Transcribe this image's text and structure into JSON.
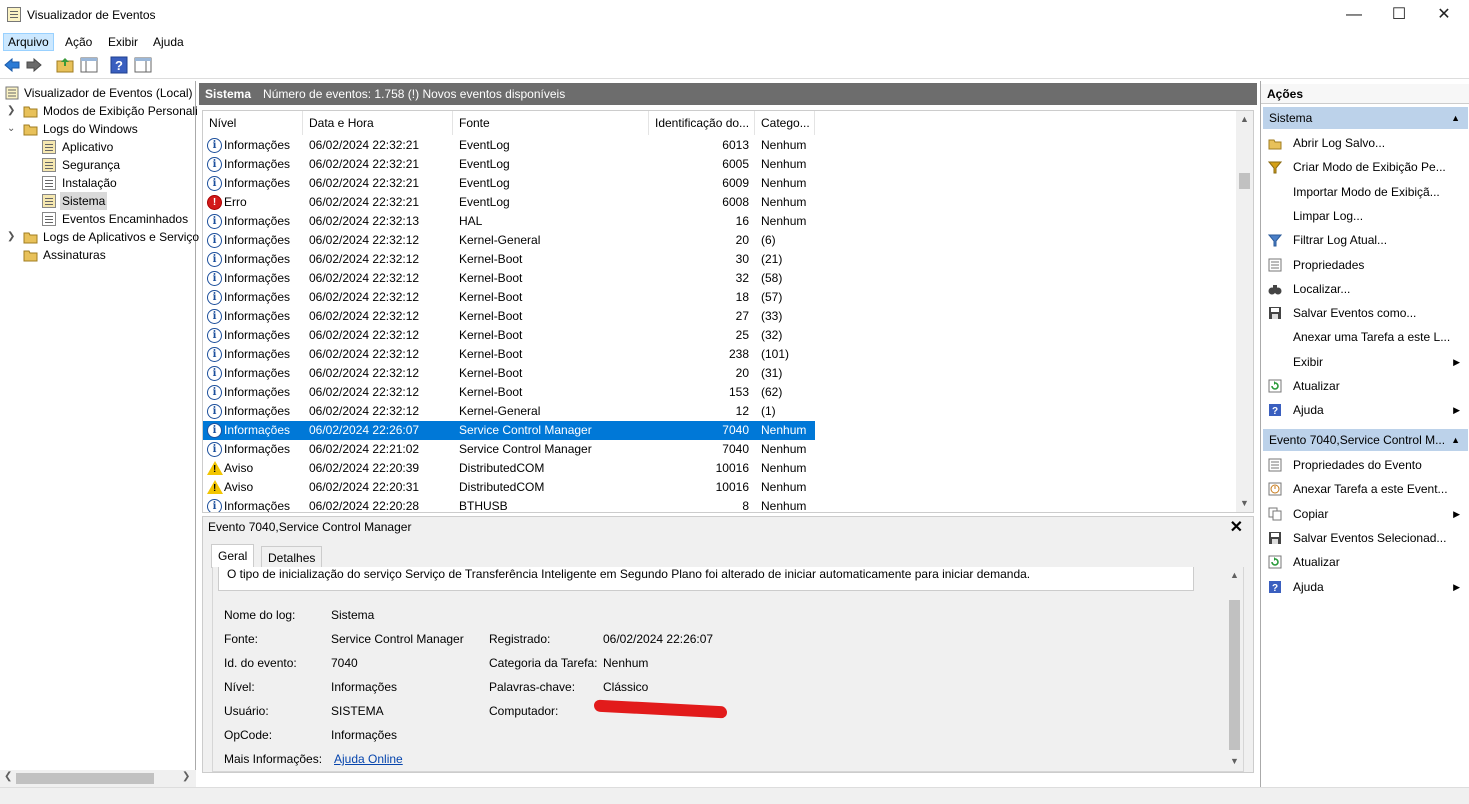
{
  "window": {
    "title": "Visualizador de Eventos"
  },
  "menu": [
    "Arquivo",
    "Ação",
    "Exibir",
    "Ajuda"
  ],
  "tree": {
    "root": "Visualizador de Eventos (Local)",
    "custom_views": "Modos de Exibição Personali",
    "windows_logs": "Logs do Windows",
    "app": "Aplicativo",
    "security": "Segurança",
    "setup": "Instalação",
    "system": "Sistema",
    "forwarded": "Eventos Encaminhados",
    "apps_services": "Logs de Aplicativos e Serviço",
    "subscriptions": "Assinaturas"
  },
  "header": {
    "log": "Sistema",
    "info": "Número de eventos: 1.758 (!) Novos eventos disponíveis"
  },
  "columns": [
    "Nível",
    "Data e Hora",
    "Fonte",
    "Identificação do...",
    "Catego..."
  ],
  "events": [
    {
      "level": "Informações",
      "type": "info",
      "date": "06/02/2024 22:32:21",
      "source": "EventLog",
      "id": "6013",
      "cat": "Nenhum"
    },
    {
      "level": "Informações",
      "type": "info",
      "date": "06/02/2024 22:32:21",
      "source": "EventLog",
      "id": "6005",
      "cat": "Nenhum"
    },
    {
      "level": "Informações",
      "type": "info",
      "date": "06/02/2024 22:32:21",
      "source": "EventLog",
      "id": "6009",
      "cat": "Nenhum"
    },
    {
      "level": "Erro",
      "type": "error",
      "date": "06/02/2024 22:32:21",
      "source": "EventLog",
      "id": "6008",
      "cat": "Nenhum"
    },
    {
      "level": "Informações",
      "type": "info",
      "date": "06/02/2024 22:32:13",
      "source": "HAL",
      "id": "16",
      "cat": "Nenhum"
    },
    {
      "level": "Informações",
      "type": "info",
      "date": "06/02/2024 22:32:12",
      "source": "Kernel-General",
      "id": "20",
      "cat": "(6)"
    },
    {
      "level": "Informações",
      "type": "info",
      "date": "06/02/2024 22:32:12",
      "source": "Kernel-Boot",
      "id": "30",
      "cat": "(21)"
    },
    {
      "level": "Informações",
      "type": "info",
      "date": "06/02/2024 22:32:12",
      "source": "Kernel-Boot",
      "id": "32",
      "cat": "(58)"
    },
    {
      "level": "Informações",
      "type": "info",
      "date": "06/02/2024 22:32:12",
      "source": "Kernel-Boot",
      "id": "18",
      "cat": "(57)"
    },
    {
      "level": "Informações",
      "type": "info",
      "date": "06/02/2024 22:32:12",
      "source": "Kernel-Boot",
      "id": "27",
      "cat": "(33)"
    },
    {
      "level": "Informações",
      "type": "info",
      "date": "06/02/2024 22:32:12",
      "source": "Kernel-Boot",
      "id": "25",
      "cat": "(32)"
    },
    {
      "level": "Informações",
      "type": "info",
      "date": "06/02/2024 22:32:12",
      "source": "Kernel-Boot",
      "id": "238",
      "cat": "(101)"
    },
    {
      "level": "Informações",
      "type": "info",
      "date": "06/02/2024 22:32:12",
      "source": "Kernel-Boot",
      "id": "20",
      "cat": "(31)"
    },
    {
      "level": "Informações",
      "type": "info",
      "date": "06/02/2024 22:32:12",
      "source": "Kernel-Boot",
      "id": "153",
      "cat": "(62)"
    },
    {
      "level": "Informações",
      "type": "info",
      "date": "06/02/2024 22:32:12",
      "source": "Kernel-General",
      "id": "12",
      "cat": "(1)"
    },
    {
      "level": "Informações",
      "type": "info",
      "date": "06/02/2024 22:26:07",
      "source": "Service Control Manager",
      "id": "7040",
      "cat": "Nenhum",
      "selected": true
    },
    {
      "level": "Informações",
      "type": "info",
      "date": "06/02/2024 22:21:02",
      "source": "Service Control Manager",
      "id": "7040",
      "cat": "Nenhum"
    },
    {
      "level": "Aviso",
      "type": "warning",
      "date": "06/02/2024 22:20:39",
      "source": "DistributedCOM",
      "id": "10016",
      "cat": "Nenhum"
    },
    {
      "level": "Aviso",
      "type": "warning",
      "date": "06/02/2024 22:20:31",
      "source": "DistributedCOM",
      "id": "10016",
      "cat": "Nenhum"
    },
    {
      "level": "Informações",
      "type": "info",
      "date": "06/02/2024 22:20:28",
      "source": "BTHUSB",
      "id": "8",
      "cat": "Nenhum"
    }
  ],
  "detail": {
    "title": "Evento 7040,Service Control Manager",
    "tabs": [
      "Geral",
      "Detalhes"
    ],
    "description": "O tipo de inicialização do serviço Serviço de Transferência Inteligente em Segundo Plano foi alterado de iniciar automaticamente para iniciar demanda.",
    "log_name_label": "Nome do log:",
    "log_name": "Sistema",
    "source_label": "Fonte:",
    "source": "Service Control Manager",
    "logged_label": "Registrado:",
    "logged": "06/02/2024 22:26:07",
    "event_id_label": "Id. do evento:",
    "event_id": "7040",
    "task_cat_label": "Categoria da Tarefa:",
    "task_cat": "Nenhum",
    "level_label": "Nível:",
    "level": "Informações",
    "keywords_label": "Palavras-chave:",
    "keywords": "Clássico",
    "user_label": "Usuário:",
    "user": "SISTEMA",
    "computer_label": "Computador:",
    "opcode_label": "OpCode:",
    "opcode": "Informações",
    "more_info_label": "Mais Informações:",
    "more_info": "Ajuda Online"
  },
  "actions": {
    "title": "Ações",
    "section1": "Sistema",
    "items1": [
      {
        "label": "Abrir Log Salvo...",
        "icon": "folder-open-icon"
      },
      {
        "label": "Criar Modo de Exibição Pe...",
        "icon": "filter-icon"
      },
      {
        "label": "Importar Modo de Exibiçã...",
        "icon": ""
      },
      {
        "label": "Limpar Log...",
        "icon": ""
      },
      {
        "label": "Filtrar Log Atual...",
        "icon": "funnel-icon"
      },
      {
        "label": "Propriedades",
        "icon": "properties-icon"
      },
      {
        "label": "Localizar...",
        "icon": "binoculars-icon"
      },
      {
        "label": "Salvar Eventos como...",
        "icon": "save-icon"
      },
      {
        "label": "Anexar uma Tarefa a este L...",
        "icon": ""
      },
      {
        "label": "Exibir",
        "icon": "",
        "submenu": true
      },
      {
        "label": "Atualizar",
        "icon": "refresh-icon"
      },
      {
        "label": "Ajuda",
        "icon": "help-icon",
        "submenu": true
      }
    ],
    "section2": "Evento 7040,Service Control M...",
    "items2": [
      {
        "label": "Propriedades do Evento",
        "icon": "properties-icon"
      },
      {
        "label": "Anexar Tarefa a este Event...",
        "icon": "task-icon"
      },
      {
        "label": "Copiar",
        "icon": "copy-icon",
        "submenu": true
      },
      {
        "label": "Salvar Eventos Selecionad...",
        "icon": "save-icon"
      },
      {
        "label": "Atualizar",
        "icon": "refresh-icon"
      },
      {
        "label": "Ajuda",
        "icon": "help-icon",
        "submenu": true
      }
    ]
  }
}
